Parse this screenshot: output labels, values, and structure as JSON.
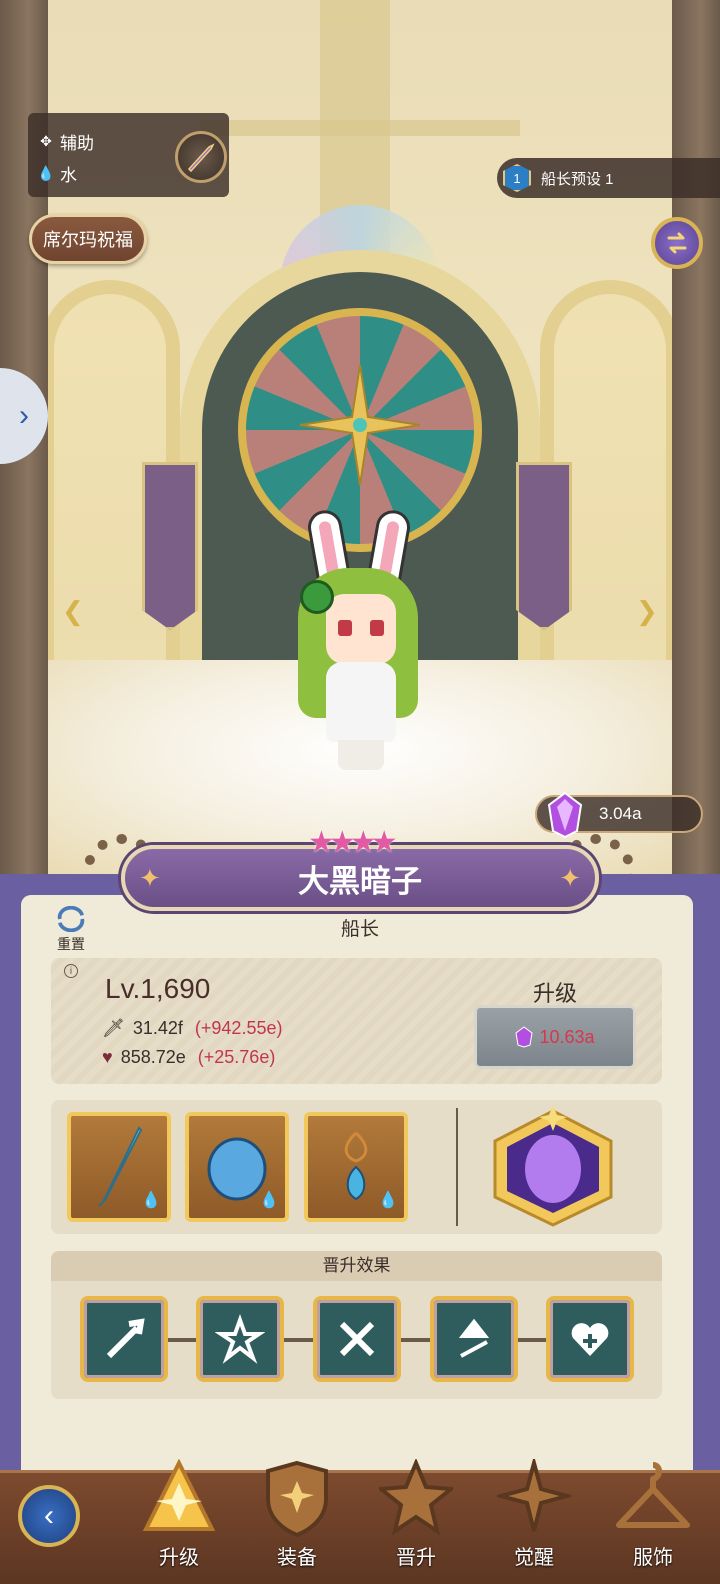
{
  "hero": {
    "role_tag": "辅助",
    "element_tag": "水",
    "blessing_label": "席尔玛祝福",
    "preset_number": "1",
    "preset_label": "船长预设 1",
    "currency_value": "3.04a",
    "stars": 4,
    "name": "大黑暗子",
    "title": "船长"
  },
  "panel": {
    "reset_label": "重置",
    "level": "Lv.1,690",
    "attack": "31.42f",
    "attack_bonus": "(+942.55e)",
    "hp": "858.72e",
    "hp_bonus": "(+25.76e)",
    "upgrade_title": "升级",
    "upgrade_cost": "10.63a",
    "promotion_title": "晋升效果"
  },
  "nav": {
    "items": [
      {
        "label": "升级"
      },
      {
        "label": "装备"
      },
      {
        "label": "晋升"
      },
      {
        "label": "觉醒"
      },
      {
        "label": "服饰"
      }
    ]
  },
  "colors": {
    "accent_purple": "#6a4f86",
    "cost_red": "#d8364d",
    "bonus_red": "#c2364d",
    "gold": "#e7b74a"
  }
}
